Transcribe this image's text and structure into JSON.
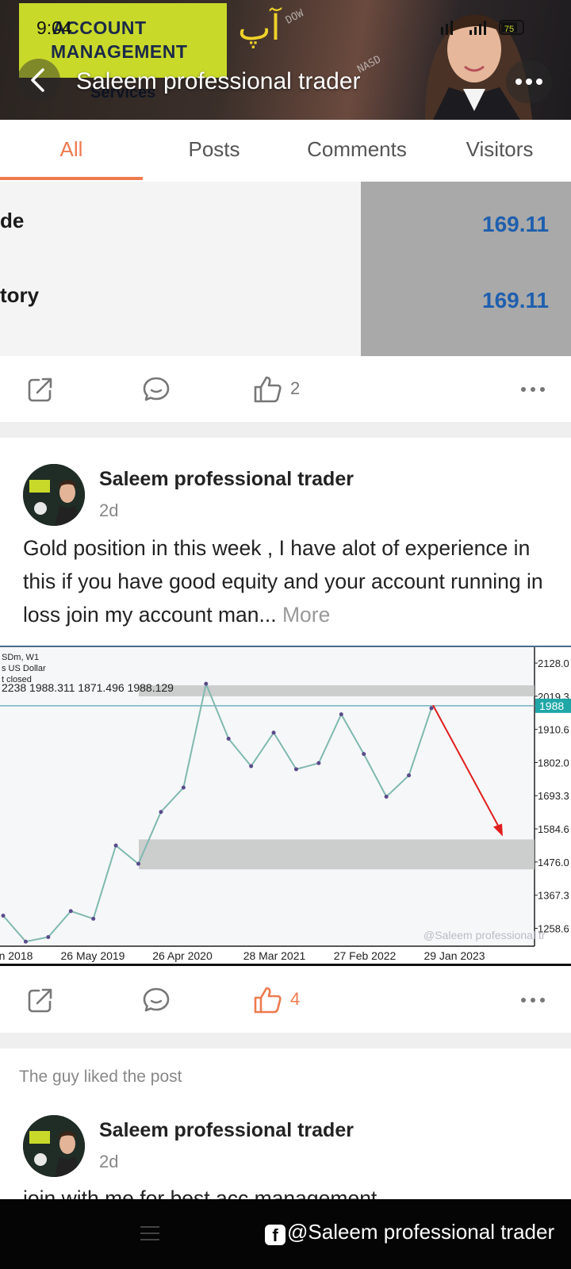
{
  "status_bar": {
    "time": "9:04",
    "battery": "75",
    "network": "4G"
  },
  "header": {
    "banner_line1": "ACCOUNT",
    "banner_line2": "MANAGEMENT",
    "banner_line3": "Services",
    "banner_urdu": "آپ",
    "banner_ticker_1": "DOW",
    "banner_ticker_2": "NASD",
    "title": "Saleem professional trader"
  },
  "tabs": [
    "All",
    "Posts",
    "Comments",
    "Visitors"
  ],
  "active_tab": 0,
  "previous_post": {
    "image_rows": [
      {
        "label": "de",
        "value": "169.11"
      },
      {
        "label": "tory",
        "value": "169.11"
      }
    ],
    "like_count": "2"
  },
  "post": {
    "author": "Saleem professional trader",
    "time": "2d",
    "text": "Gold position in this week , I have alot of experience in this if you have good equity and your account running in loss join my account man...",
    "more_label": "More",
    "like_count": "4"
  },
  "chart_data": {
    "type": "line",
    "header_lines": [
      "SDm, W1",
      "s US Dollar",
      "t closed"
    ],
    "ohlc_text": "2238 1988.311 1871.496 1988.129",
    "x_tick_labels": [
      "n 2018",
      "26 May 2019",
      "26 Apr 2020",
      "28 Mar 2021",
      "27 Feb 2022",
      "29 Jan 2023"
    ],
    "y_tick_labels": [
      "2128.0",
      "2019.3",
      "1910.6",
      "1802.0",
      "1693.3",
      "1584.6",
      "1476.0",
      "1367.3",
      "1258.6"
    ],
    "current_price_label": "1988",
    "watermark": "@Saleem professional tr",
    "ylim": [
      1200,
      2180
    ],
    "zones": [
      {
        "from": 2019,
        "to": 2055
      },
      {
        "from": 1452,
        "to": 1550
      }
    ],
    "series": [
      {
        "x": [
          "2018-04",
          "2018-08",
          "2018-11",
          "2019-02",
          "2019-05",
          "2019-08",
          "2019-11",
          "2020-02",
          "2020-05",
          "2020-08",
          "2020-11",
          "2021-02",
          "2021-05",
          "2021-08",
          "2021-11",
          "2022-02",
          "2022-05",
          "2022-08",
          "2022-11",
          "2023-02"
        ],
        "values": [
          1300,
          1215,
          1230,
          1315,
          1290,
          1530,
          1470,
          1640,
          1720,
          2060,
          1880,
          1790,
          1900,
          1780,
          1800,
          1960,
          1830,
          1690,
          1760,
          1980
        ]
      }
    ],
    "forecast_arrow": {
      "from": 1990,
      "to": 1560
    }
  },
  "activity_note": "The guy liked the post",
  "post2": {
    "author": "Saleem professional trader",
    "time": "2d",
    "text": "join with me for best acc management"
  },
  "watermark": "@Saleem professional trader",
  "colors": {
    "accent": "#ee7a4f",
    "arrow": "#e01e1e",
    "value_blue": "#1f5fae"
  }
}
